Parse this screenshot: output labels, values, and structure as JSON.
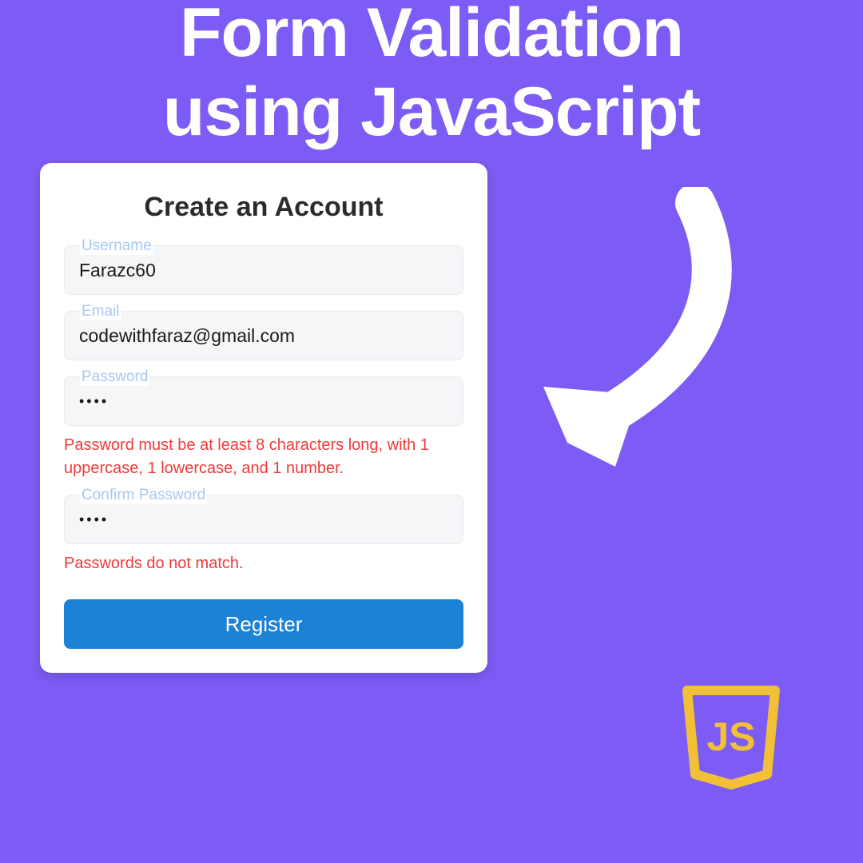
{
  "headline": {
    "line1": "Form Validation",
    "line2": "using JavaScript"
  },
  "form": {
    "title": "Create an Account",
    "fields": {
      "username": {
        "label": "Username",
        "value": "Farazc60"
      },
      "email": {
        "label": "Email",
        "value": "codewithfaraz@gmail.com"
      },
      "password": {
        "label": "Password",
        "value": "••••",
        "error": "Password must be at least 8 characters long, with 1 uppercase, 1 lowercase, and 1 number."
      },
      "confirm_password": {
        "label": "Confirm Password",
        "value": "••••",
        "error": "Passwords do not match."
      }
    },
    "submit_label": "Register"
  },
  "badge": {
    "text": "JS"
  }
}
